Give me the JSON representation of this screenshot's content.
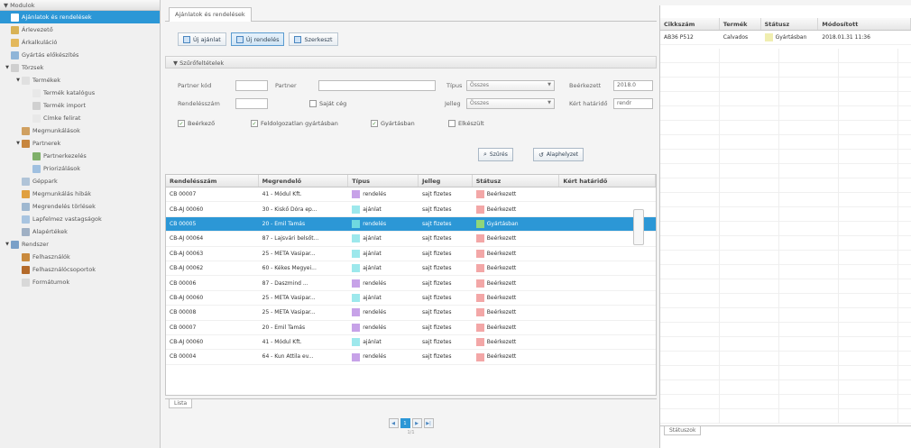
{
  "sidebar": {
    "header": "Modulok",
    "items": [
      {
        "label": "Ajánlatok és rendelések",
        "level": 1,
        "toggle": "",
        "icon_color": "#ffffff",
        "selected": true,
        "icon": "document-icon"
      },
      {
        "label": "Árlevezető",
        "level": 1,
        "toggle": "",
        "icon_color": "#d8b255",
        "selected": false,
        "icon": "price-icon"
      },
      {
        "label": "Árkalkuláció",
        "level": 1,
        "toggle": "",
        "icon_color": "#e3b85c",
        "selected": false,
        "icon": "calc-icon"
      },
      {
        "label": "Gyártás előkészítés",
        "level": 1,
        "toggle": "",
        "icon_color": "#8fb5d8",
        "selected": false,
        "icon": "prep-icon"
      },
      {
        "label": "Törzsek",
        "level": 1,
        "toggle": "▼",
        "icon_color": "#cfcfcf",
        "selected": false,
        "icon": "folder-icon"
      },
      {
        "label": "Termékek",
        "level": 2,
        "toggle": "▼",
        "icon_color": "#e0e0e0",
        "selected": false,
        "icon": "folder-icon"
      },
      {
        "label": "Termék katalógus",
        "level": 3,
        "toggle": "",
        "icon_color": "#e8e8e8",
        "selected": false,
        "icon": "catalog-icon"
      },
      {
        "label": "Termék import",
        "level": 3,
        "toggle": "",
        "icon_color": "#d0d0d0",
        "selected": false,
        "icon": "import-icon"
      },
      {
        "label": "Címke felirat",
        "level": 3,
        "toggle": "",
        "icon_color": "#e8e8e8",
        "selected": false,
        "icon": "label-icon"
      },
      {
        "label": "Megmunkálások",
        "level": 2,
        "toggle": "",
        "icon_color": "#d0a060",
        "selected": false,
        "icon": "tools-icon"
      },
      {
        "label": "Partnerek",
        "level": 2,
        "toggle": "▼",
        "icon_color": "#c7863f",
        "selected": false,
        "icon": "partners-icon"
      },
      {
        "label": "Partnerkezelés",
        "level": 3,
        "toggle": "",
        "icon_color": "#7fb06a",
        "selected": false,
        "icon": "partner-icon"
      },
      {
        "label": "Priorizálások",
        "level": 3,
        "toggle": "",
        "icon_color": "#a0c0e0",
        "selected": false,
        "icon": "priority-icon"
      },
      {
        "label": "Géppark",
        "level": 2,
        "toggle": "",
        "icon_color": "#b0c4d8",
        "selected": false,
        "icon": "machine-icon"
      },
      {
        "label": "Megmunkálás hibák",
        "level": 2,
        "toggle": "",
        "icon_color": "#e0a040",
        "selected": false,
        "icon": "warning-icon"
      },
      {
        "label": "Megrendelés törlések",
        "level": 2,
        "toggle": "",
        "icon_color": "#9fb8d0",
        "selected": false,
        "icon": "delete-icon"
      },
      {
        "label": "Lapfelmez vastagságok",
        "level": 2,
        "toggle": "",
        "icon_color": "#a8c4e0",
        "selected": false,
        "icon": "thickness-icon"
      },
      {
        "label": "Alapértékek",
        "level": 2,
        "toggle": "",
        "icon_color": "#9fb0c4",
        "selected": false,
        "icon": "defaults-icon"
      },
      {
        "label": "Rendszer",
        "level": 1,
        "toggle": "▼",
        "icon_color": "#7aa0c8",
        "selected": false,
        "icon": "system-icon"
      },
      {
        "label": "Felhasználók",
        "level": 2,
        "toggle": "",
        "icon_color": "#c98a3e",
        "selected": false,
        "icon": "user-icon"
      },
      {
        "label": "Felhasználócsoportok",
        "level": 2,
        "toggle": "",
        "icon_color": "#b46a2a",
        "selected": false,
        "icon": "group-icon"
      },
      {
        "label": "Formátumok",
        "level": 2,
        "toggle": "",
        "icon_color": "#d8d8d8",
        "selected": false,
        "icon": "format-icon"
      }
    ]
  },
  "center": {
    "tab_label": "Ajánlatok és rendelések",
    "toolbar": {
      "new_offer": "Új ajánlat",
      "new_order": "Új rendelés",
      "edit": "Szerkeszt"
    },
    "filter_title": "Szűrőfeltételek",
    "filters": {
      "partner_id_label": "Partner kód",
      "partner_label": "Partner",
      "order_number_label": "Rendelésszám",
      "own_label": "Saját cég",
      "type_label": "Típus",
      "type_value": "Összes",
      "nature_label": "Jelleg",
      "nature_value": "Összes",
      "received_label": "Beérkezett",
      "received_value": "2018.0",
      "deadline_label": "Kért határidő",
      "deadline_value": "rendr",
      "cb_received": "Beérkező",
      "cb_in_production": "Feldolgozatlan gyártásban",
      "cb_produced": "Gyártásban",
      "cb_closed": "Elkészült",
      "search_button": "Szűrés",
      "reset_button": "Alaphelyzet"
    },
    "table": {
      "headers": [
        "Rendelésszám",
        "Megrendelő",
        "Típus",
        "Jelleg",
        "Státusz",
        "Kért határidő"
      ],
      "rows": [
        {
          "id": "CB 00007",
          "client": "41 - Módul Kft.",
          "type": "rendelés",
          "type_color": "#c7a2e8",
          "nature": "sajt fizetes",
          "status": "Beérkezett",
          "status_color": "#f3a7a7",
          "deadline": "",
          "selected": false
        },
        {
          "id": "CB-AJ 00060",
          "client": "30 - Kiskő Dóra ep...",
          "type": "ajánlat",
          "type_color": "#9de8ec",
          "nature": "sajt fizetes",
          "status": "Beérkezett",
          "status_color": "#f3a7a7",
          "deadline": "",
          "selected": false
        },
        {
          "id": "CB 00005",
          "client": "20 - Emil Tamás",
          "type": "rendelés",
          "type_color": "#6fd8e0",
          "nature": "sajt fizetes",
          "status": "Gyártásban",
          "status_color": "#8fd67a",
          "deadline": "",
          "selected": true
        },
        {
          "id": "CB-AJ 00064",
          "client": "87 - Lajsvári belsőt...",
          "type": "ajánlat",
          "type_color": "#9de8ec",
          "nature": "sajt fizetes",
          "status": "Beérkezett",
          "status_color": "#f3a7a7",
          "deadline": "",
          "selected": false
        },
        {
          "id": "CB-AJ 00063",
          "client": "25 - META Vasipar...",
          "type": "ajánlat",
          "type_color": "#9de8ec",
          "nature": "sajt fizetes",
          "status": "Beérkezett",
          "status_color": "#f3a7a7",
          "deadline": "",
          "selected": false
        },
        {
          "id": "CB-AJ 00062",
          "client": "60 - Kékes Megyei...",
          "type": "ajánlat",
          "type_color": "#9de8ec",
          "nature": "sajt fizetes",
          "status": "Beérkezett",
          "status_color": "#f3a7a7",
          "deadline": "",
          "selected": false
        },
        {
          "id": "CB 00006",
          "client": "87 - Daszmind ...",
          "type": "rendelés",
          "type_color": "#c7a2e8",
          "nature": "sajt fizetes",
          "status": "Beérkezett",
          "status_color": "#f3a7a7",
          "deadline": "",
          "selected": false
        },
        {
          "id": "CB-AJ 00060",
          "client": "25 - META Vasipar...",
          "type": "ajánlat",
          "type_color": "#9de8ec",
          "nature": "sajt fizetes",
          "status": "Beérkezett",
          "status_color": "#f3a7a7",
          "deadline": "",
          "selected": false
        },
        {
          "id": "CB 00008",
          "client": "25 - META Vasipar...",
          "type": "rendelés",
          "type_color": "#c7a2e8",
          "nature": "sajt fizetes",
          "status": "Beérkezett",
          "status_color": "#f3a7a7",
          "deadline": "",
          "selected": false
        },
        {
          "id": "CB 00007",
          "client": "20 - Emil Tamás",
          "type": "rendelés",
          "type_color": "#c7a2e8",
          "nature": "sajt fizetes",
          "status": "Beérkezett",
          "status_color": "#f3a7a7",
          "deadline": "",
          "selected": false
        },
        {
          "id": "CB-AJ 00060",
          "client": "41 - Módul Kft.",
          "type": "ajánlat",
          "type_color": "#9de8ec",
          "nature": "sajt fizetes",
          "status": "Beérkezett",
          "status_color": "#f3a7a7",
          "deadline": "",
          "selected": false
        },
        {
          "id": "CB 00004",
          "client": "64 - Kun Attila ev...",
          "type": "rendelés",
          "type_color": "#c7a2e8",
          "nature": "sajt fizetes",
          "status": "Beérkezett",
          "status_color": "#f3a7a7",
          "deadline": "",
          "selected": false
        }
      ]
    },
    "list_tab": "Lista",
    "pager": {
      "prev": "◀",
      "current": "1",
      "next": "▶",
      "last": "▶|",
      "info": "1/1"
    }
  },
  "right": {
    "headers": [
      "Cikkszám",
      "Termék",
      "Státusz",
      "Módosított"
    ],
    "rows": [
      {
        "sku": "AB36 P512",
        "product": "Calvados",
        "status": "Gyártásban",
        "status_color": "#f0eeb0",
        "modified": "2018.01.31 11:36"
      }
    ],
    "tab_label": "Státuszok"
  }
}
